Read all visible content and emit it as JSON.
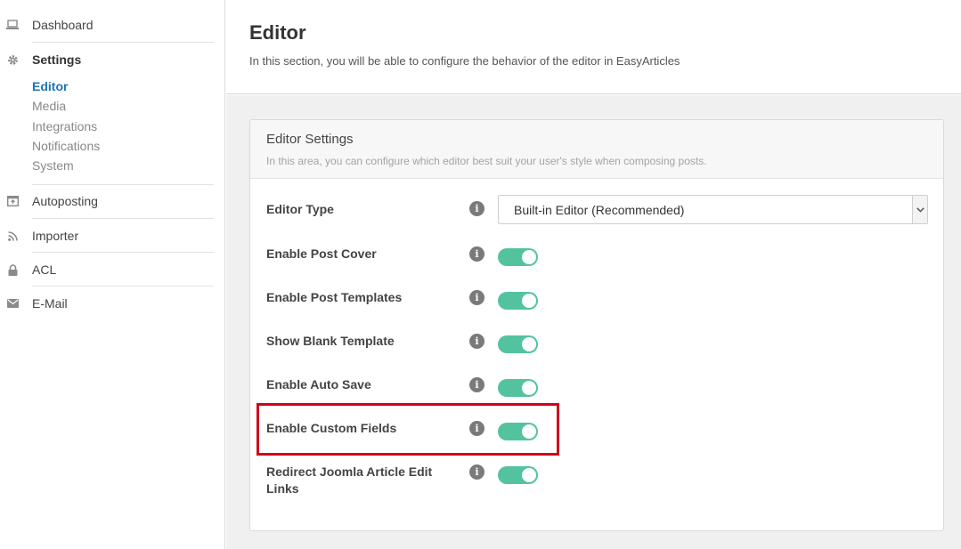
{
  "sidebar": {
    "items": [
      {
        "label": "Dashboard",
        "icon": "laptop-icon"
      },
      {
        "label": "Settings",
        "icon": "gear-icon"
      },
      {
        "label": "Autoposting",
        "icon": "autopost-icon"
      },
      {
        "label": "Importer",
        "icon": "rss-icon"
      },
      {
        "label": "ACL",
        "icon": "lock-icon"
      },
      {
        "label": "E-Mail",
        "icon": "envelope-icon"
      }
    ],
    "settings_subitems": [
      "Editor",
      "Media",
      "Integrations",
      "Notifications",
      "System"
    ],
    "current_subitem": "Editor"
  },
  "header": {
    "title": "Editor",
    "description": "In this section, you will be able to configure the behavior of the editor in EasyArticles"
  },
  "panel": {
    "title": "Editor Settings",
    "subtitle": "In this area, you can configure which editor best suit your user's style when composing posts.",
    "editor_type": {
      "label": "Editor Type",
      "selected": "Built-in Editor (Recommended)"
    },
    "toggles": [
      {
        "label": "Enable Post Cover",
        "on": true
      },
      {
        "label": "Enable Post Templates",
        "on": true
      },
      {
        "label": "Show Blank Template",
        "on": true
      },
      {
        "label": "Enable Auto Save",
        "on": true
      },
      {
        "label": "Enable Custom Fields",
        "on": true,
        "highlighted": true
      },
      {
        "label": "Redirect Joomla Article Edit Links",
        "on": true
      }
    ]
  },
  "colors": {
    "accent_link": "#1f73b7",
    "toggle_on": "#53c39f",
    "highlight_border": "#d0021b"
  }
}
